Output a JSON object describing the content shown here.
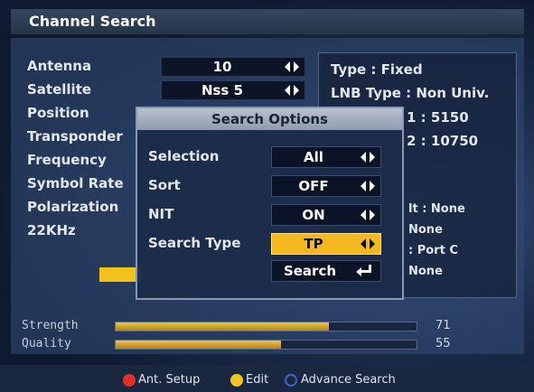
{
  "title": "Channel Search",
  "settings": [
    {
      "label": "Antenna",
      "value": "10"
    },
    {
      "label": "Satellite",
      "value": "Nss 5"
    },
    {
      "label": "Position"
    },
    {
      "label": "Transponder"
    },
    {
      "label": "Frequency"
    },
    {
      "label": "Symbol Rate"
    },
    {
      "label": "Polarization"
    },
    {
      "label": "22KHz"
    }
  ],
  "info": {
    "type": "Type : Fixed",
    "lnb_type": "LNB Type : Non Univ.",
    "lnb1": "1 : 5150",
    "lnb2": "2 : 10750",
    "line5": "lt : None",
    "line6": "None",
    "line7": ": Port C",
    "line8": "None"
  },
  "dialog": {
    "title": "Search Options",
    "options": [
      {
        "label": "Selection",
        "value": "All"
      },
      {
        "label": "Sort",
        "value": "OFF"
      },
      {
        "label": "NIT",
        "value": "ON"
      },
      {
        "label": "Search Type",
        "value": "TP",
        "selected": true
      }
    ],
    "search_label": "Search"
  },
  "meters": {
    "strength": {
      "label": "Strength",
      "value": 71
    },
    "quality": {
      "label": "Quality",
      "value": 55
    }
  },
  "footer": {
    "red_label": "Ant. Setup",
    "yellow_label": "Edit",
    "blue_label": "Advance Search"
  },
  "colors": {
    "highlight": "#f5b81e",
    "red": "#e23030",
    "yellow": "#f3c522",
    "blue": "#3d63c9"
  }
}
